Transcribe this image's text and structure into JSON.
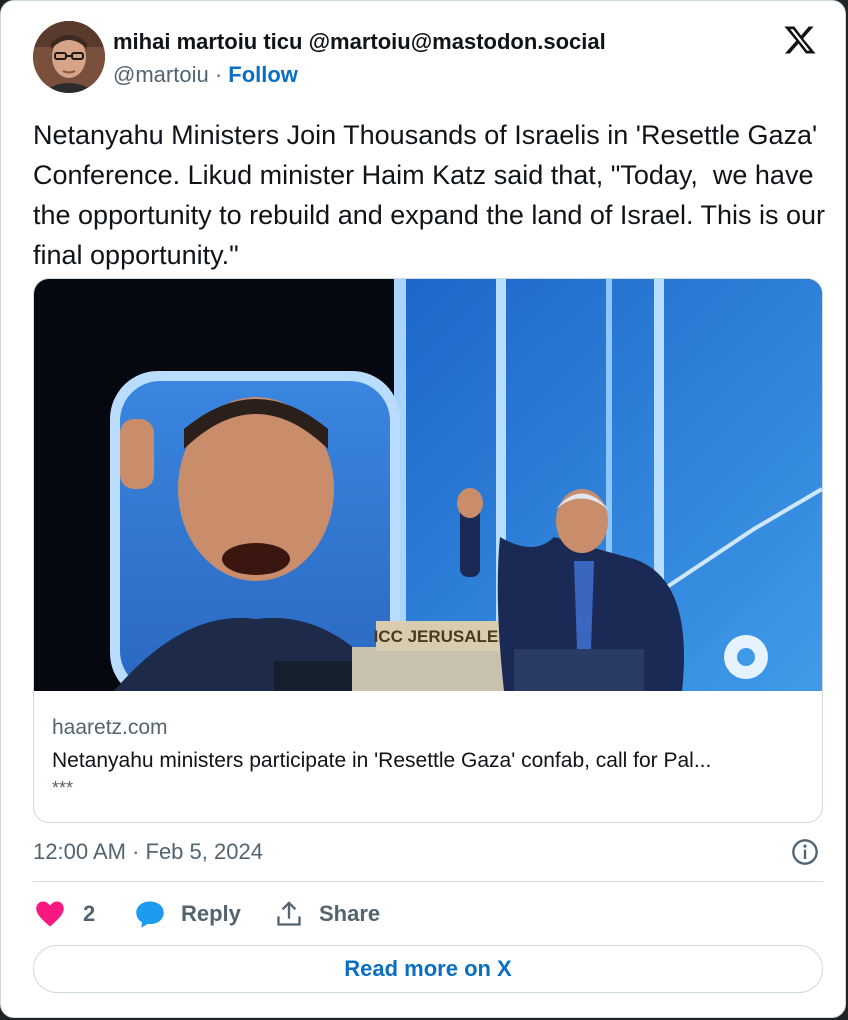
{
  "author": {
    "name": "mihai martoiu ticu @martoiu@mastodon.social",
    "handle": "@martoiu",
    "separator": " · ",
    "follow_label": "Follow"
  },
  "brand_icon": "x-logo-icon",
  "tweet": {
    "text": "Netanyahu Ministers Join Thousands of Israelis in 'Resettle Gaza' Conference. Likud minister Haim Katz said that, \"Today,  we have the opportunity to rebuild and expand the land of Israel. This is our final opportunity.\""
  },
  "link_card": {
    "podium_sign": "ICC JERUSALEM",
    "domain": "haaretz.com",
    "title": "Netanyahu ministers participate in 'Resettle Gaza' confab, call for Pal...",
    "description": "***"
  },
  "meta": {
    "timestamp": "12:00 AM · Feb 5, 2024"
  },
  "actions": {
    "like_count": "2",
    "reply_label": "Reply",
    "share_label": "Share"
  },
  "read_more_label": "Read more on X",
  "colors": {
    "link_blue": "#0a6fc2",
    "heart_pink": "#f91880",
    "reply_blue": "#1d9bf0",
    "secondary_text": "#536471",
    "primary_text": "#0f1419",
    "border": "#cfd9de"
  }
}
